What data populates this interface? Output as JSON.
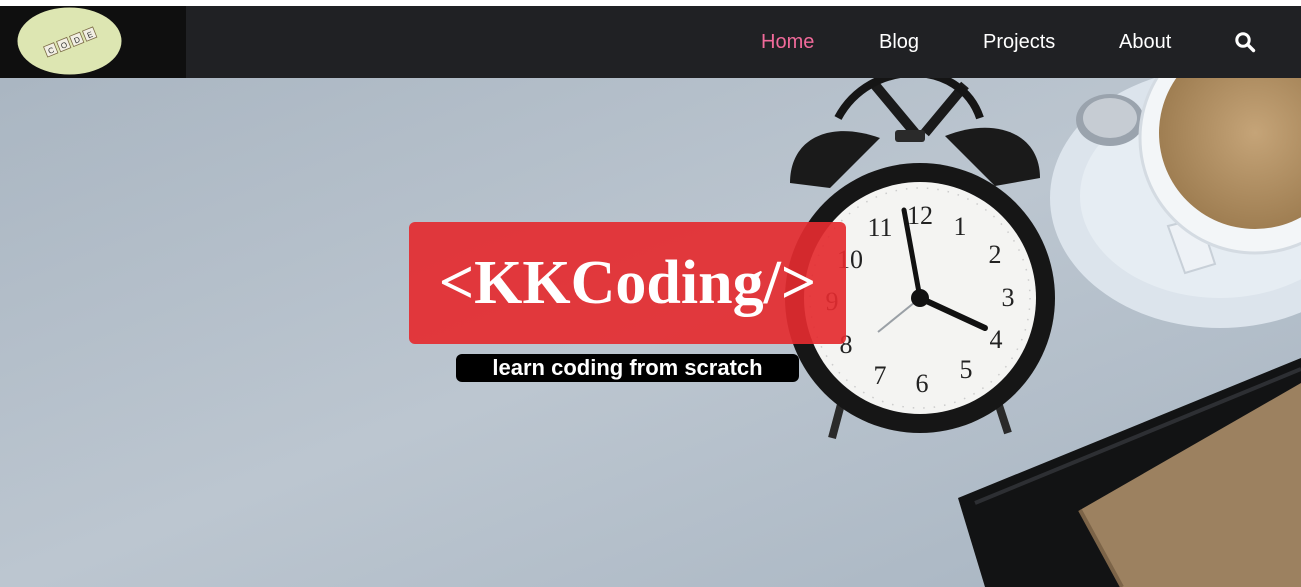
{
  "logo": {
    "tiles": [
      "C",
      "O",
      "D",
      "E"
    ],
    "colors": {
      "oval": "#dde6b2",
      "tile": "#f2efe4",
      "tile_text": "#333333"
    }
  },
  "nav": {
    "items": [
      {
        "label": "Home",
        "active": true
      },
      {
        "label": "Blog",
        "active": false
      },
      {
        "label": "Projects",
        "active": false
      },
      {
        "label": "About",
        "active": false
      }
    ],
    "search_icon": "search-icon"
  },
  "hero": {
    "title": "<KKCoding/>",
    "tagline": "learn coding from scratch",
    "clock_numbers": [
      "12",
      "1",
      "2",
      "3",
      "4",
      "5",
      "6",
      "7",
      "8",
      "9",
      "10",
      "11"
    ],
    "colors": {
      "title_box": "#e42b30",
      "tagline_box": "#000000",
      "background": "#b0bcc8"
    }
  },
  "colors": {
    "navbar": "#202124",
    "logo_panel": "#0f0f0f",
    "active_link": "#f06a9a",
    "link": "#ffffff"
  }
}
